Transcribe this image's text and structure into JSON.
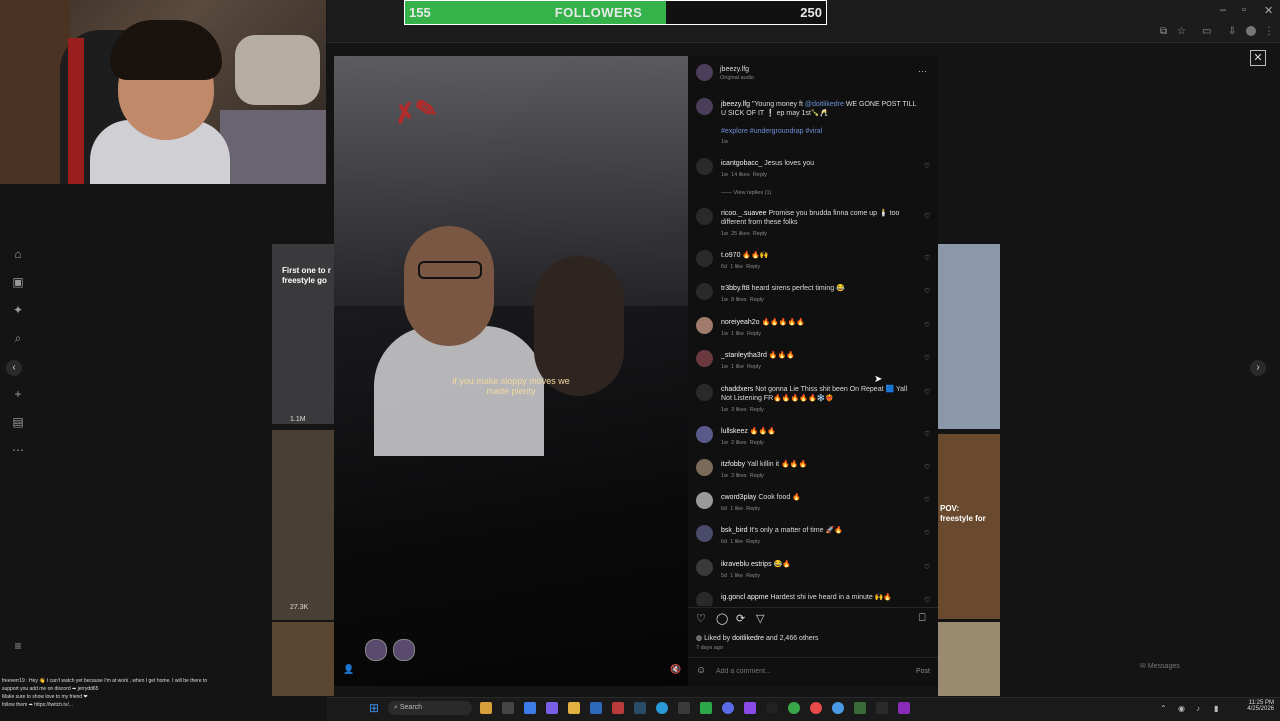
{
  "follower_goal": {
    "current": "155",
    "label": "FOLLOWERS",
    "target": "250",
    "progress_fraction": 0.62
  },
  "window_controls": {
    "minimize": "–",
    "maximize": "▫",
    "close": "✕"
  },
  "close_overlay": "✕",
  "post": {
    "author": "jbeezy.lfg",
    "audio": "Original audio",
    "caption_user": "jbeezy.lfg",
    "caption_text_1": "\"Young money ft",
    "caption_mention": "@doitlikedre",
    "caption_text_2": "WE GONE POST TILL U SICK OF IT ❕ ep may 1st🍾🥂",
    "hashtags": "#explore #undergroundrap #viral",
    "caption_age": "1w",
    "video_caption_line1": "if you make sloppy moves we",
    "video_caption_line2": "made plenty",
    "liked_by_prefix": "Liked by",
    "liked_by_user": "doitlikedre",
    "liked_by_suffix": "and 2,466 others",
    "posted_ago": "7 days ago",
    "comment_placeholder": "Add a comment...",
    "post_button": "Post",
    "more_icon": "···"
  },
  "comments": [
    {
      "user": "icantgobacc_",
      "text": "Jesus loves you",
      "age": "1w",
      "likes": "14 likes",
      "reply": "Reply",
      "view_replies": "View replies (1)"
    },
    {
      "user": "ricoo._.suavee",
      "text": "Promise you brudda finna come up 🕯️ too different from these folks",
      "age": "1w",
      "likes": "25 likes",
      "reply": "Reply"
    },
    {
      "user": "t.o970",
      "text": "🔥🔥🙌",
      "age": "6d",
      "likes": "1 like",
      "reply": "Reply"
    },
    {
      "user": "tr3bby.ft8",
      "text": "heard sirens perfect timing 😂",
      "age": "1w",
      "likes": "8 likes",
      "reply": "Reply"
    },
    {
      "user": "noreiyeah2o",
      "text": "🔥🔥🔥🔥🔥",
      "age": "1w",
      "likes": "1 like",
      "reply": "Reply"
    },
    {
      "user": "_stanleytha3rd",
      "text": "🔥🔥🔥",
      "age": "1w",
      "likes": "1 like",
      "reply": "Reply"
    },
    {
      "user": "chaddxers",
      "text": "Not gonna Lie Thiss shit been On Repeat 🟦 Yall Not Listening FR🔥🔥🔥🔥🔥❄️❤️‍🔥",
      "age": "1w",
      "likes": "3 likes",
      "reply": "Reply"
    },
    {
      "user": "lullskeez",
      "text": "🔥🔥🔥",
      "age": "1w",
      "likes": "2 likes",
      "reply": "Reply"
    },
    {
      "user": "itzfobby",
      "text": "Yall killin it 🔥🔥🔥",
      "age": "1w",
      "likes": "3 likes",
      "reply": "Reply"
    },
    {
      "user": "cword3play",
      "text": "Cook food 🔥",
      "age": "6d",
      "likes": "1 like",
      "reply": "Reply"
    },
    {
      "user": "bsk_bird",
      "text": "It's only a matter of time 🚀🔥",
      "age": "6d",
      "likes": "1 like",
      "reply": "Reply"
    },
    {
      "user": "ikraveblu estrips",
      "text": "😂🔥",
      "age": "5d",
      "likes": "1 like",
      "reply": "Reply"
    },
    {
      "user": "ig.goncl appme",
      "text": "Hardest shi ive heard in a minute 🙌🔥",
      "age": "",
      "likes": "",
      "reply": ""
    }
  ],
  "background_posts": {
    "left_text_1": "First one to r",
    "left_text_2": "freestyle go",
    "left_views_1": "1.1M",
    "left_views_2": "27.3K",
    "right_text_1": "POV:",
    "right_text_2": "freestyle for"
  },
  "messages_button": "Messages",
  "chat": {
    "line1": "freeverr19 : Hey 👋 I can't watch yet because I'm at work , when I get home. I will be there to",
    "line2": "support you add me on discord ➡ jerrydd65",
    "line3": "Make sure to show love to my friend ❤",
    "line4": "follow them ➡ https://twitch.tv/..."
  },
  "taskbar": {
    "search_label": "Search",
    "time": "11:25 PM",
    "date": "4/25/2026"
  },
  "colors": {
    "progress_green": "#35b34a",
    "panel_bg": "#101010",
    "mention_blue": "#6f8fd8"
  }
}
